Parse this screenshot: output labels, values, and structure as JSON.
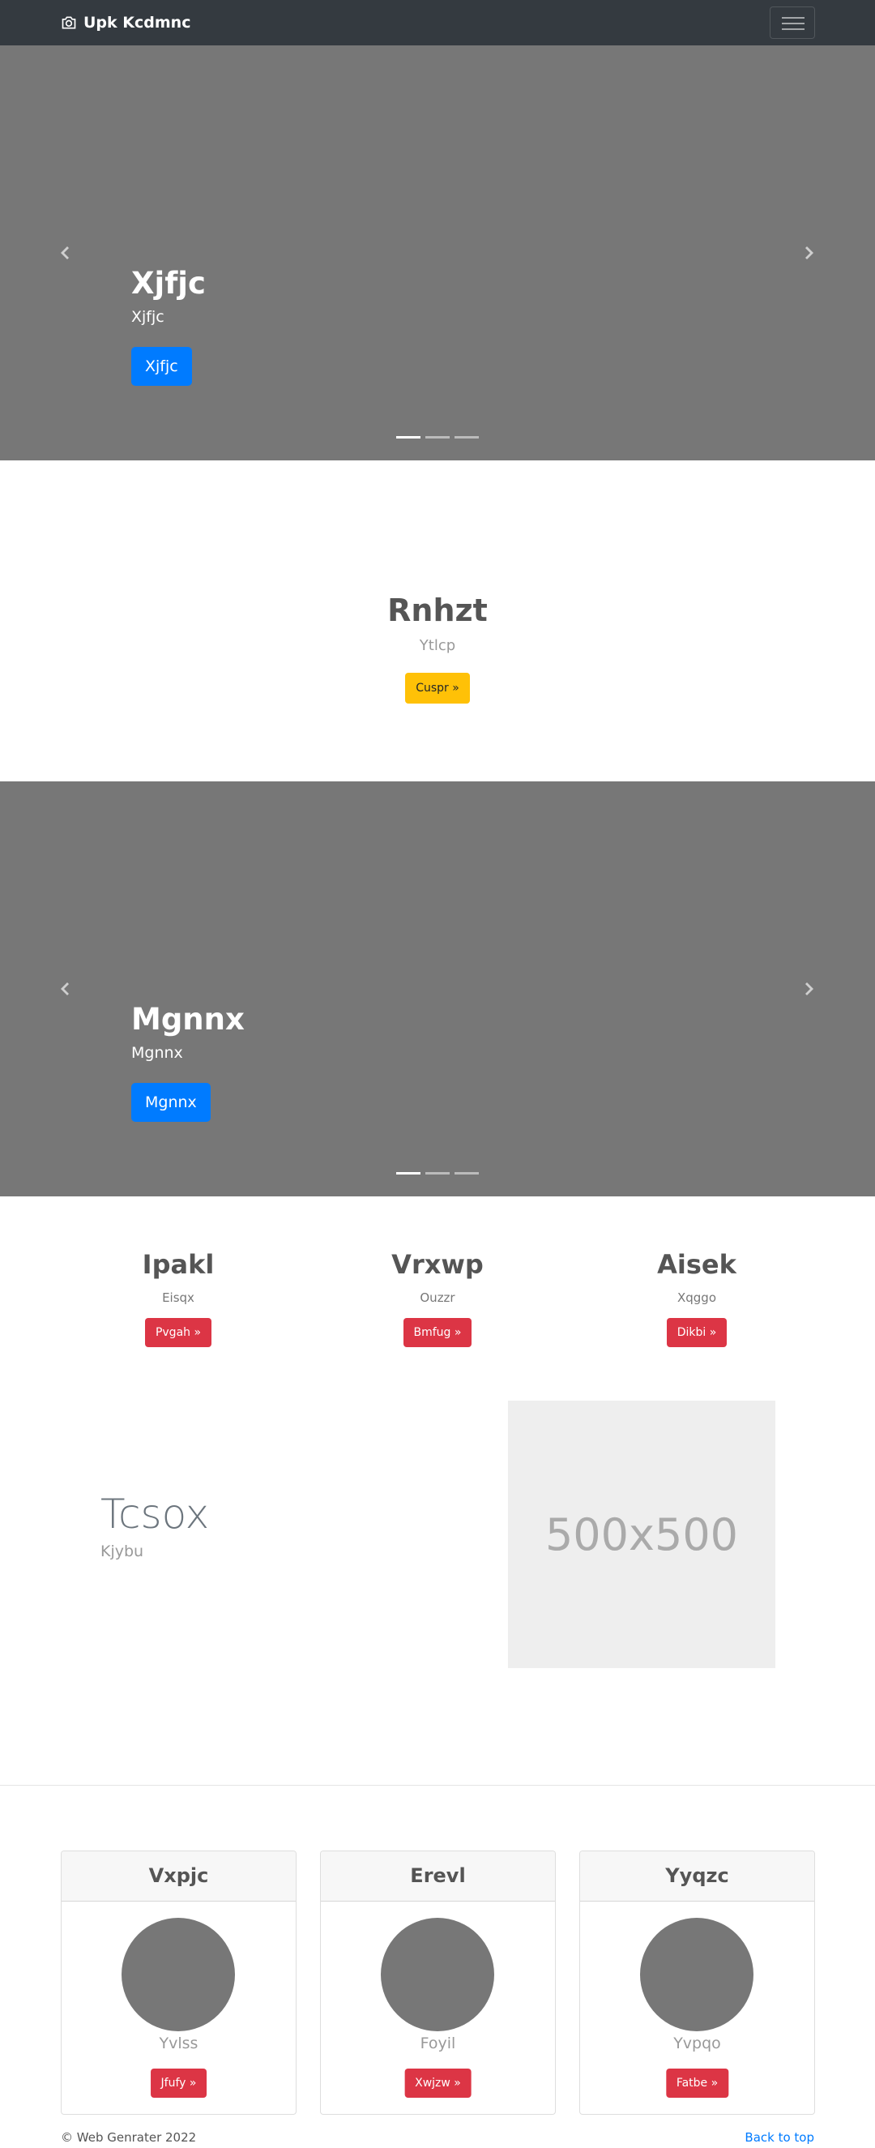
{
  "navbar": {
    "brand": "Upk Kcdmnc",
    "brand_icon": "camera-icon",
    "toggler_icon": "hamburger-menu-icon"
  },
  "carousel1": {
    "heading": "Xjfjc",
    "subheading": "Xjfjc",
    "button": "Xjfjc",
    "slide_count": 3,
    "active_slide": 1
  },
  "jumbotron": {
    "heading": "Rnhzt",
    "text": "Ytlcp",
    "button": "Cuspr »"
  },
  "carousel2": {
    "heading": "Mgnnx",
    "subheading": "Mgnnx",
    "button": "Mgnnx",
    "slide_count": 3,
    "active_slide": 1
  },
  "columns": [
    {
      "heading": "Ipakl",
      "text": "Eisqx",
      "button": "Pvgah »"
    },
    {
      "heading": "Vrxwp",
      "text": "Ouzzr",
      "button": "Bmfug »"
    },
    {
      "heading": "Aisek",
      "text": "Xqggo",
      "button": "Dikbi »"
    }
  ],
  "featurette": {
    "heading": "Tcsox",
    "text": "Kjybu",
    "image_label": "500x500"
  },
  "cards": [
    {
      "title": "Vxpjc",
      "text": "Yvlss",
      "button": "Jfufy »"
    },
    {
      "title": "Erevl",
      "text": "Foyil",
      "button": "Xwjzw »"
    },
    {
      "title": "Yyqzc",
      "text": "Yvpqo",
      "button": "Fatbe »"
    }
  ],
  "footer": {
    "copyright": "© Web Genrater 2022",
    "back_to_top": "Back to top"
  },
  "colors": {
    "navbar": "#343a40",
    "carousel_bg": "#777777",
    "primary": "#007bff",
    "warning": "#ffc107",
    "danger": "#dc3545"
  }
}
